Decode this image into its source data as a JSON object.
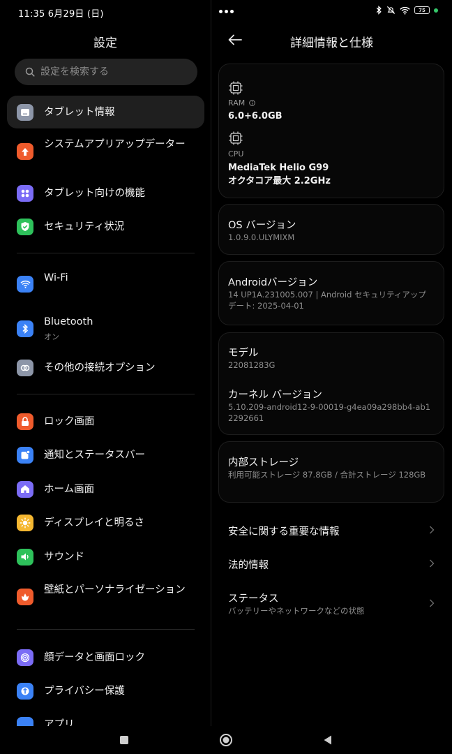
{
  "status_bar": {
    "time_date": "11:35  6月29日 (日)",
    "battery": "75"
  },
  "left": {
    "title": "設定",
    "search_placeholder": "設定を検索する",
    "items": [
      {
        "label": "タブレット情報",
        "icon": "tablet-icon",
        "color": "#8d96a8"
      },
      {
        "label": "システムアプリアップデーター",
        "icon": "arrow-up-icon",
        "color": "#ef5b2c"
      },
      {
        "label": "タブレット向けの機能",
        "icon": "grid-icon",
        "color": "#7b6cf6"
      },
      {
        "label": "セキュリティ状況",
        "icon": "shield-check-icon",
        "color": "#2ec15b"
      },
      {
        "label": "Wi-Fi",
        "icon": "wifi-icon",
        "color": "#3b82f6"
      },
      {
        "label": "Bluetooth",
        "sub": "オン",
        "icon": "bluetooth-icon",
        "color": "#3b82f6"
      },
      {
        "label": "その他の接続オプション",
        "icon": "link-icon",
        "color": "#8d96a8"
      },
      {
        "label": "ロック画面",
        "icon": "lock-icon",
        "color": "#ef5b2c"
      },
      {
        "label": "通知とステータスバー",
        "icon": "notification-icon",
        "color": "#3b82f6"
      },
      {
        "label": "ホーム画面",
        "icon": "home-icon",
        "color": "#7b6cf6"
      },
      {
        "label": "ディスプレイと明るさ",
        "icon": "sun-icon",
        "color": "#f5b731"
      },
      {
        "label": "サウンド",
        "icon": "speaker-icon",
        "color": "#2ec15b"
      },
      {
        "label": "壁紙とパーソナライゼーション",
        "icon": "tulip-icon",
        "color": "#ef5b2c"
      },
      {
        "label": "顔データと画面ロック",
        "icon": "fingerprint-icon",
        "color": "#7b6cf6"
      },
      {
        "label": "プライバシー保護",
        "icon": "privacy-icon",
        "color": "#3b82f6"
      },
      {
        "label": "アプリ",
        "icon": "apps-icon",
        "color": "#3b82f6"
      }
    ]
  },
  "right": {
    "title": "詳細情報と仕様",
    "ram_caption": "RAM",
    "ram_value": "6.0+6.0GB",
    "cpu_caption": "CPU",
    "cpu_value_1": "MediaTek Helio G99",
    "cpu_value_2": "オクタコア最大 2.2GHz",
    "os_title": "OS バージョン",
    "os_value": "1.0.9.0.ULYMIXM",
    "android_title": "Androidバージョン",
    "android_value": "14 UP1A.231005.007 | Android セキュリティアップデート: 2025-04-01",
    "model_title": "モデル",
    "model_value": "22081283G",
    "kernel_title": "カーネル バージョン",
    "kernel_value": "5.10.209-android12-9-00019-g4ea09a298bb4-ab12292661",
    "storage_title": "内部ストレージ",
    "storage_value": "利用可能ストレージ  87.8GB / 合計ストレージ 128GB",
    "safety_label": "安全に関する重要な情報",
    "legal_label": "法的情報",
    "status_label": "ステータス",
    "status_sub": "バッテリーやネットワークなどの状態"
  }
}
